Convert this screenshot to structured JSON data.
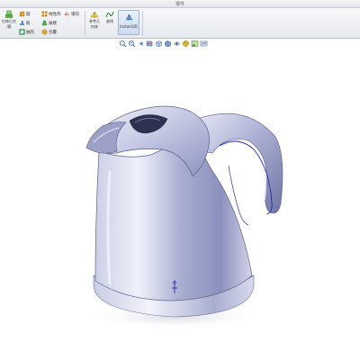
{
  "window": {
    "title": "零件"
  },
  "ribbon": {
    "big_buttons": [
      {
        "name": "extrude-boss-button",
        "label": "拉伸凸台",
        "label2": "/基",
        "icon": "extrude-boss-icon"
      },
      {
        "name": "reference-geometry-button",
        "label": "参考几",
        "label2": "何体",
        "icon": "reference-geometry-icon"
      },
      {
        "name": "curves-button",
        "label": "曲线",
        "label2": "",
        "icon": "curves-icon"
      }
    ],
    "small_buttons": [
      {
        "name": "fillet-button",
        "label": "圆",
        "icon": "fillet-icon"
      },
      {
        "name": "rib-button",
        "label": "筋",
        "icon": "rib-icon"
      },
      {
        "name": "shell-button",
        "label": "抽壳",
        "icon": "shell-icon"
      },
      {
        "name": "linear-pattern-button",
        "label": "线性阵",
        "icon": "linear-pattern-icon"
      },
      {
        "name": "draft-button",
        "label": "拔模",
        "icon": "draft-icon"
      },
      {
        "name": "mirror-button",
        "label": "镜向",
        "icon": "mirror-icon"
      },
      {
        "name": "wrap-button",
        "label": "包覆",
        "icon": "wrap-icon"
      },
      {
        "name": "intersect-button",
        "label": "相交",
        "icon": "intersect-icon"
      }
    ],
    "instant3d": {
      "label": "Instant3D",
      "icon": "instant3d-icon"
    }
  },
  "view_toolbar": {
    "icons": [
      "zoom-to-fit-icon",
      "zoom-area-icon",
      "previous-view-icon",
      "section-view-icon",
      "view-orientation-icon",
      "display-style-icon",
      "hide-show-items-icon",
      "edit-appearance-icon",
      "apply-scene-icon",
      "view-settings-icon"
    ]
  },
  "colors": {
    "ribbon_bg": "#e9ecef",
    "kettle_body": "#a9aed0",
    "kettle_highlight": "#eef0fa",
    "kettle_shadow": "#5c6188",
    "sketch_curve": "#2a2aa8"
  }
}
